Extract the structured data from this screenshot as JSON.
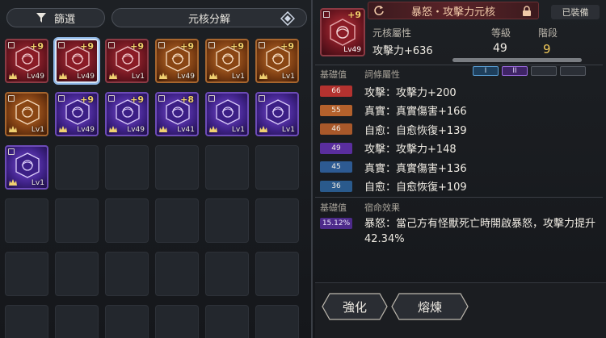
{
  "left_panel": {
    "filter_label": "篩選",
    "decompose_label": "元核分解",
    "items": [
      {
        "color": "red",
        "level": "Lv49",
        "plus": "+9"
      },
      {
        "color": "red",
        "level": "Lv49",
        "plus": "+9",
        "selected": true
      },
      {
        "color": "red",
        "level": "Lv1",
        "plus": "+9"
      },
      {
        "color": "orange",
        "level": "Lv49",
        "plus": "+9"
      },
      {
        "color": "orange",
        "level": "Lv1",
        "plus": "+9"
      },
      {
        "color": "orange",
        "level": "Lv1",
        "plus": "+9"
      },
      {
        "color": "orange",
        "level": "Lv1",
        "plus": ""
      },
      {
        "color": "purple",
        "level": "Lv49",
        "plus": "+9"
      },
      {
        "color": "purple",
        "level": "Lv49",
        "plus": "+9"
      },
      {
        "color": "purple",
        "level": "Lv41",
        "plus": "+8"
      },
      {
        "color": "purple",
        "level": "Lv1",
        "plus": ""
      },
      {
        "color": "purple",
        "level": "Lv1",
        "plus": ""
      },
      {
        "color": "purple",
        "level": "Lv1",
        "plus": ""
      }
    ]
  },
  "detail": {
    "title": "暴怒・攻擊力元核",
    "equipped_label": "已裝備",
    "item_level": "Lv49",
    "item_plus": "+9",
    "core_attr_header": "元核屬性",
    "level_header": "等級",
    "stage_header": "階段",
    "core_attr_value": "攻擊力+636",
    "level_value": "49",
    "stage_value": "9",
    "level_progress": 1.0,
    "stage_pips": [
      "I",
      "II",
      "",
      ""
    ],
    "base_value_label": "基礎值",
    "affix_label": "詞條屬性",
    "affixes": [
      {
        "badge": "66",
        "color": "#b3322f",
        "text": "攻擊：攻擊力+200"
      },
      {
        "badge": "55",
        "color": "#b4612c",
        "text": "真實：真實傷害+166"
      },
      {
        "badge": "46",
        "color": "#a8582a",
        "text": "自愈：自愈恢復+139"
      },
      {
        "badge": "49",
        "color": "#5a2e9e",
        "text": "攻擊：攻擊力+148"
      },
      {
        "badge": "45",
        "color": "#2d5a92",
        "text": "真實：真實傷害+136"
      },
      {
        "badge": "36",
        "color": "#2a5a8c",
        "text": "自愈：自愈恢復+109"
      }
    ],
    "base_value_label2": "基礎值",
    "fate_label": "宿命效果",
    "fate_badge": "15.12%",
    "fate_text": "暴怒：當己方有怪獸死亡時開啟暴怒，攻擊力提升42.34%"
  },
  "actions": {
    "enhance_label": "強化",
    "smelt_label": "熔煉"
  }
}
